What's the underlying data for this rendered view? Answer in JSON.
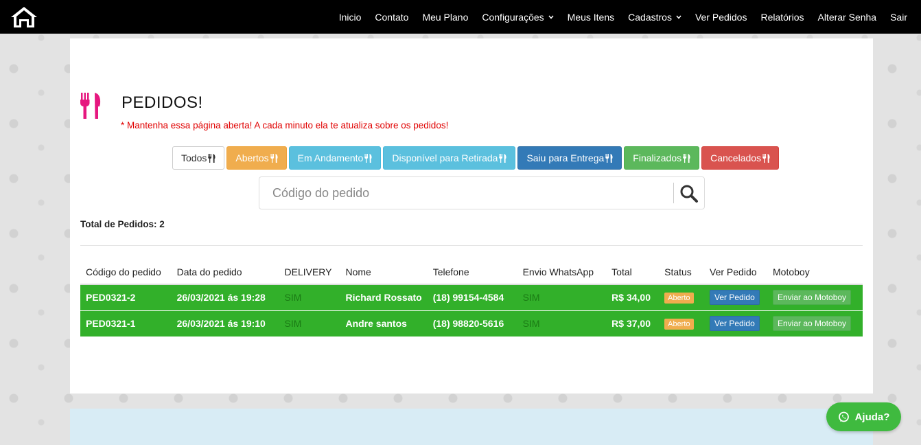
{
  "nav": {
    "items": [
      {
        "label": "Inicio",
        "dropdown": false
      },
      {
        "label": "Contato",
        "dropdown": false
      },
      {
        "label": "Meu Plano",
        "dropdown": false
      },
      {
        "label": "Configurações",
        "dropdown": true
      },
      {
        "label": "Meus Itens",
        "dropdown": false
      },
      {
        "label": "Cadastros",
        "dropdown": true
      },
      {
        "label": "Ver Pedidos",
        "dropdown": false
      },
      {
        "label": "Relatórios",
        "dropdown": false
      },
      {
        "label": "Alterar Senha",
        "dropdown": false
      },
      {
        "label": "Sair",
        "dropdown": false
      }
    ]
  },
  "page": {
    "title": "PEDIDOS!",
    "notice": "* Mantenha essa página aberta! A cada minuto ela te atualiza sobre os pedidos!"
  },
  "filters": [
    {
      "label": "Todos",
      "style": "todos"
    },
    {
      "label": "Abertos",
      "style": "abertos"
    },
    {
      "label": "Em Andamento",
      "style": "andamento"
    },
    {
      "label": "Disponível para Retirada",
      "style": "disponivel"
    },
    {
      "label": "Saiu para Entrega",
      "style": "saiu"
    },
    {
      "label": "Finalizados",
      "style": "finalizados"
    },
    {
      "label": "Cancelados",
      "style": "cancelados"
    }
  ],
  "search": {
    "placeholder": "Código do pedido",
    "value": ""
  },
  "total_label": "Total de Pedidos: 2",
  "table": {
    "headers": [
      "Código do pedido",
      "Data do pedido",
      "DELIVERY",
      "Nome",
      "Telefone",
      "Envio WhatsApp",
      "Total",
      "Status",
      "Ver Pedido",
      "Motoboy"
    ],
    "rows": [
      {
        "codigo": "PED0321-2",
        "data": "26/03/2021 ás 19:28",
        "delivery": "SIM",
        "nome": "Richard Rossato",
        "telefone": "(18) 99154-4584",
        "whatsapp": "SIM",
        "total": "R$ 34,00",
        "status": "Aberto",
        "ver": "Ver Pedido",
        "motoboy": "Enviar ao Motoboy"
      },
      {
        "codigo": "PED0321-1",
        "data": "26/03/2021 ás 19:10",
        "delivery": "SIM",
        "nome": "Andre santos",
        "telefone": "(18) 98820-5616",
        "whatsapp": "SIM",
        "total": "R$ 37,00",
        "status": "Aberto",
        "ver": "Ver Pedido",
        "motoboy": "Enviar ao Motoboy"
      }
    ]
  },
  "help": {
    "label": "Ajuda?"
  },
  "colors": {
    "accent_pink": "#e6177f",
    "row_green": "#32b02a",
    "notice_red": "#e00000"
  }
}
